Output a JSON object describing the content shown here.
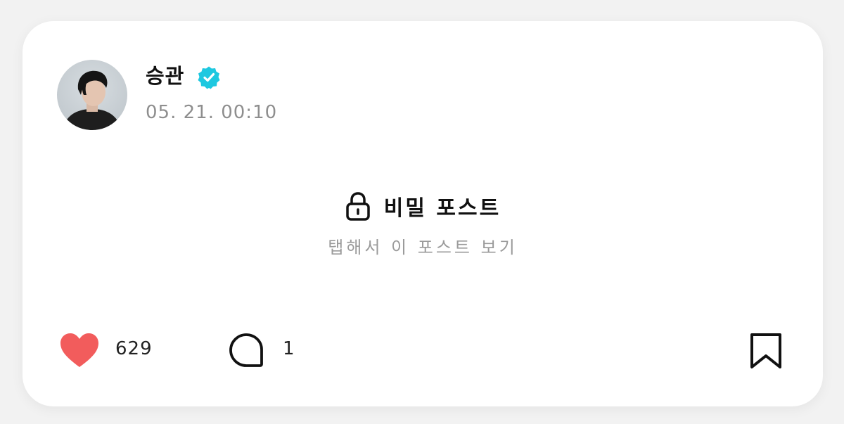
{
  "post": {
    "author": {
      "name": "승관",
      "verified": true,
      "avatar_icon": "profile-photo"
    },
    "timestamp": "05. 21. 00:10",
    "lock": {
      "icon": "lock-icon",
      "title": "비밀 포스트",
      "hint": "탭해서 이 포스트 보기"
    },
    "actions": {
      "like_icon": "heart-icon",
      "like_count": "629",
      "comment_icon": "speech-bubble-icon",
      "comment_count": "1",
      "bookmark_icon": "bookmark-icon"
    }
  },
  "colors": {
    "heart": "#f25c5c",
    "verified_badge": "#1ec8e0",
    "muted_text": "#8e8e8e",
    "primary_text": "#111111"
  }
}
